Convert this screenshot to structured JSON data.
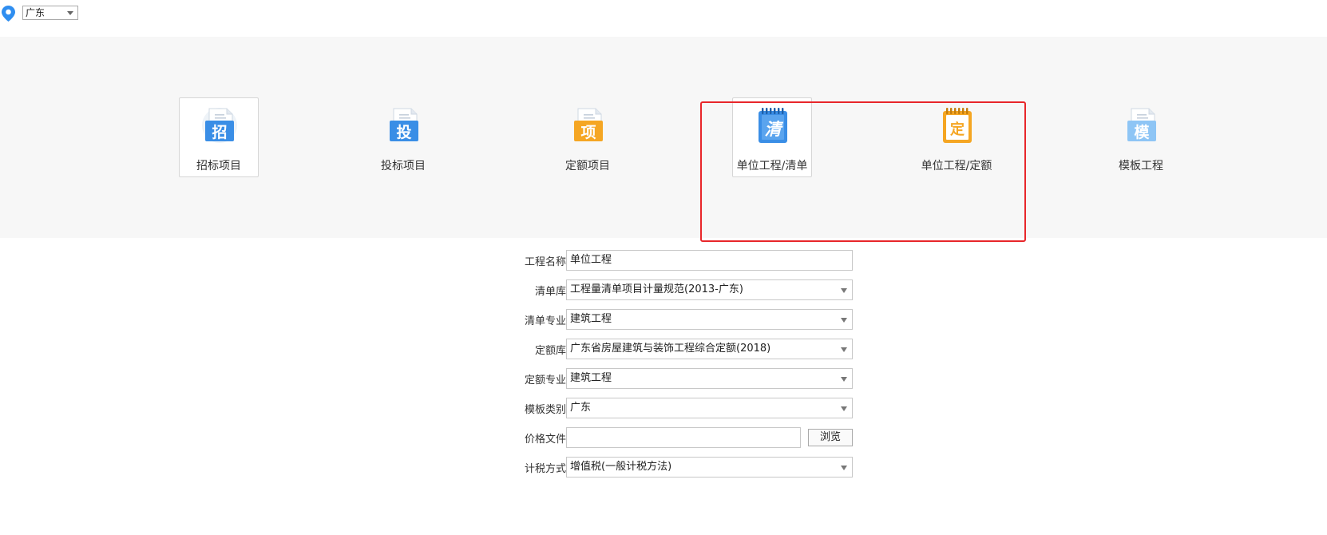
{
  "region": {
    "selected": "广东"
  },
  "project_types": [
    {
      "label": "招标项目",
      "glyph": "招",
      "icon": "document-zhao-icon",
      "color": "#3a8ee6"
    },
    {
      "label": "投标项目",
      "glyph": "投",
      "icon": "document-tou-icon",
      "color": "#3a8ee6"
    },
    {
      "label": "定额项目",
      "glyph": "项",
      "icon": "document-xiang-icon",
      "color": "#f5a623"
    },
    {
      "label": "单位工程/清单",
      "glyph": "清",
      "icon": "notebook-qing-icon",
      "color": "#3a8ee6"
    },
    {
      "label": "单位工程/定额",
      "glyph": "定",
      "icon": "notebook-ding-icon",
      "color": "#f5a623"
    },
    {
      "label": "模板工程",
      "glyph": "模",
      "icon": "document-mo-icon",
      "color": "#8ec5f5"
    }
  ],
  "highlight_color": "#e8262a",
  "form": {
    "project_name": {
      "label": "工程名称",
      "value": "单位工程"
    },
    "bill_library": {
      "label": "清单库",
      "value": "工程量清单项目计量规范(2013-广东)"
    },
    "bill_specialty": {
      "label": "清单专业",
      "value": "建筑工程"
    },
    "quota_library": {
      "label": "定额库",
      "value": "广东省房屋建筑与装饰工程综合定额(2018)"
    },
    "quota_specialty": {
      "label": "定额专业",
      "value": "建筑工程"
    },
    "template_type": {
      "label": "模板类别",
      "value": "广东"
    },
    "price_file": {
      "label": "价格文件",
      "value": "",
      "browse_label": "浏览"
    },
    "tax_method": {
      "label": "计税方式",
      "value": "增值税(一般计税方法)"
    }
  }
}
